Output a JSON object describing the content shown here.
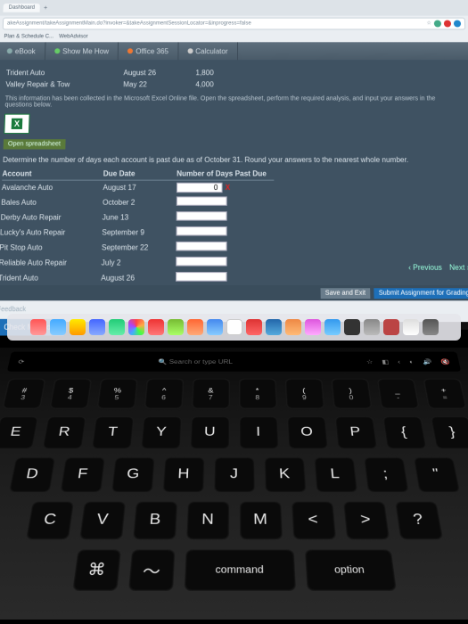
{
  "browser": {
    "tabs": [
      "Dashboard"
    ],
    "url": "akeAssignment/takeAssignmentMain.do?invoker=&takeAssignmentSessionLocator=&inprogress=false",
    "bookmarks": [
      "Plan & Schedule C...",
      "WebAdvisor"
    ]
  },
  "apptabs": {
    "ebook": "eBook",
    "show": "Show Me How",
    "office": "Office 365",
    "calc": "Calculator"
  },
  "top_rows": [
    {
      "name": "Trident Auto",
      "date": "August 26",
      "val": "1,800"
    },
    {
      "name": "Valley Repair & Tow",
      "date": "May 22",
      "val": "4,000"
    }
  ],
  "info_line": "This information has been collected in the Microsoft Excel Online file. Open the spreadsheet, perform the required analysis, and input your answers in the questions below.",
  "open_spreadsheet": "Open spreadsheet",
  "instruction": "Determine the number of days each account is past due as of October 31. Round your answers to the nearest whole number.",
  "table": {
    "headers": {
      "account": "Account",
      "due": "Due Date",
      "days": "Number of Days Past Due"
    },
    "rows": [
      {
        "account": "Avalanche Auto",
        "due": "August 17",
        "val": "0",
        "mark": "x"
      },
      {
        "account": "Bales Auto",
        "due": "October 2",
        "val": "",
        "mark": ""
      },
      {
        "account": "Derby Auto Repair",
        "due": "June 13",
        "val": "",
        "mark": ""
      },
      {
        "account": "Lucky's Auto Repair",
        "due": "September 9",
        "val": "",
        "mark": ""
      },
      {
        "account": "Pit Stop Auto",
        "due": "September 22",
        "val": "",
        "mark": ""
      },
      {
        "account": "Reliable Auto Repair",
        "due": "July 2",
        "val": "",
        "mark": ""
      },
      {
        "account": "Trident Auto",
        "due": "August 26",
        "val": "",
        "mark": ""
      },
      {
        "account": "Valley Repair & Tow",
        "due": "May 22",
        "val": "",
        "mark": ""
      }
    ]
  },
  "feedback": "Feedback",
  "check": "Check My Work",
  "prev": "Previous",
  "next": "Next",
  "save_exit": "Save and Exit",
  "submit": "Submit Assignment for Grading",
  "touchbar": {
    "search": "Search or type URL"
  },
  "keys": {
    "numrow": [
      {
        "t": "#",
        "b": "3"
      },
      {
        "t": "$",
        "b": "4"
      },
      {
        "t": "%",
        "b": "5"
      },
      {
        "t": "^",
        "b": "6"
      },
      {
        "t": "&",
        "b": "7"
      },
      {
        "t": "*",
        "b": "8"
      },
      {
        "t": "(",
        "b": "9"
      },
      {
        "t": ")",
        "b": "0"
      },
      {
        "t": "_",
        "b": "-"
      },
      {
        "t": "+",
        "b": "="
      }
    ],
    "r1": [
      "E",
      "R",
      "T",
      "Y",
      "U",
      "I",
      "O",
      "P",
      "{",
      "}"
    ],
    "r2": [
      "D",
      "F",
      "G",
      "H",
      "J",
      "K",
      "L",
      ";",
      "\""
    ],
    "r3": [
      "C",
      "V",
      "B",
      "N",
      "M",
      "<",
      ">",
      "?"
    ],
    "cmd": "command",
    "opt": "option"
  }
}
